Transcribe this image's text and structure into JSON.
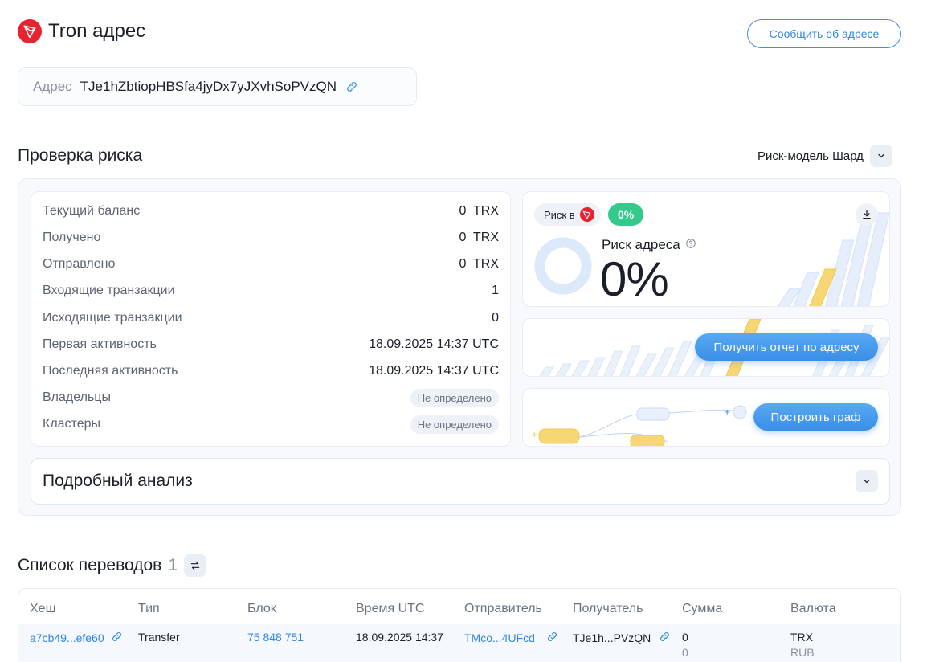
{
  "page": {
    "title": "Tron адрес",
    "report_button": "Сообщить об адресе"
  },
  "address": {
    "label": "Адрес",
    "value": "TJe1hZbtiopHBSfa4jyDx7yJXvhSoPVzQN"
  },
  "risk_check": {
    "title": "Проверка риска",
    "model_label": "Риск-модель Шард",
    "stats": [
      {
        "label": "Текущий баланс",
        "value": "0  TRX"
      },
      {
        "label": "Получено",
        "value": "0  TRX"
      },
      {
        "label": "Отправлено",
        "value": "0  TRX"
      },
      {
        "label": "Входящие транзакции",
        "value": "1"
      },
      {
        "label": "Исходящие транзакции",
        "value": "0"
      },
      {
        "label": "Первая активность",
        "value": "18.09.2025 14:37 UTC"
      },
      {
        "label": "Последняя активность",
        "value": "18.09.2025 14:37 UTC"
      },
      {
        "label": "Владельцы",
        "value": "Не определено"
      },
      {
        "label": "Кластеры",
        "value": "Не определено"
      }
    ],
    "risk_in_label": "Риск в",
    "risk_badge": "0%",
    "score_label": "Риск адреса",
    "score_value": "0%",
    "score_fraction": 0,
    "get_report_button": "Получить отчет по адресу",
    "build_graph_button": "Построить граф",
    "analysis_title": "Подробный анализ"
  },
  "colors": {
    "accent": "#3a8ee6",
    "tron_red": "#e8222f",
    "risk_green": "#36c98c",
    "donut": "#dce9fb"
  },
  "transfers": {
    "title": "Список переводов",
    "count": "1",
    "columns": [
      "Хеш",
      "Тип",
      "Блок",
      "Время UTC",
      "Отправитель",
      "Получатель",
      "Сумма",
      "Валюта"
    ],
    "rows": [
      {
        "hash": "a7cb49...efe60",
        "type": "Transfer",
        "block": "75 848 751",
        "time": "18.09.2025 14:37",
        "sender": "TMco...4UFcd",
        "recipient": "TJe1h...PVzQN",
        "amount": "0",
        "amount_alt": "0",
        "currency": "TRX",
        "currency_alt": "RUB"
      }
    ]
  },
  "icons": {
    "logo": "tron-logo-icon",
    "copy_link": "link-icon",
    "chevron": "chevron-down-icon",
    "download": "download-icon",
    "info": "question-circle-icon",
    "filter": "swap-arrows-icon"
  }
}
